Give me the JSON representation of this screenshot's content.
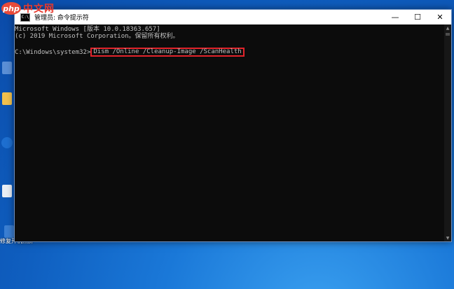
{
  "watermark": {
    "badge": "php",
    "text": "中文网"
  },
  "desktop": {
    "icons": [
      {
        "label": ""
      },
      {
        "label": ""
      },
      {
        "label": ""
      },
      {
        "label": ""
      },
      {
        "label": "修复开机黑屏"
      }
    ]
  },
  "window": {
    "title": "管理员: 命令提示符",
    "app_icon_text": "C:\\",
    "controls": {
      "minimize": "—",
      "maximize": "☐",
      "close": "✕"
    }
  },
  "console": {
    "line1": "Microsoft Windows [版本 10.0.18363.657]",
    "line2": "(c) 2019 Microsoft Corporation。保留所有权利。",
    "prompt": "C:\\Windows\\system32>",
    "command": "Dism /Online /Cleanup-Image /ScanHealth"
  },
  "colors": {
    "highlight": "#e2242b",
    "console_bg": "#0c0c0c",
    "console_fg": "#c0c0c0"
  }
}
